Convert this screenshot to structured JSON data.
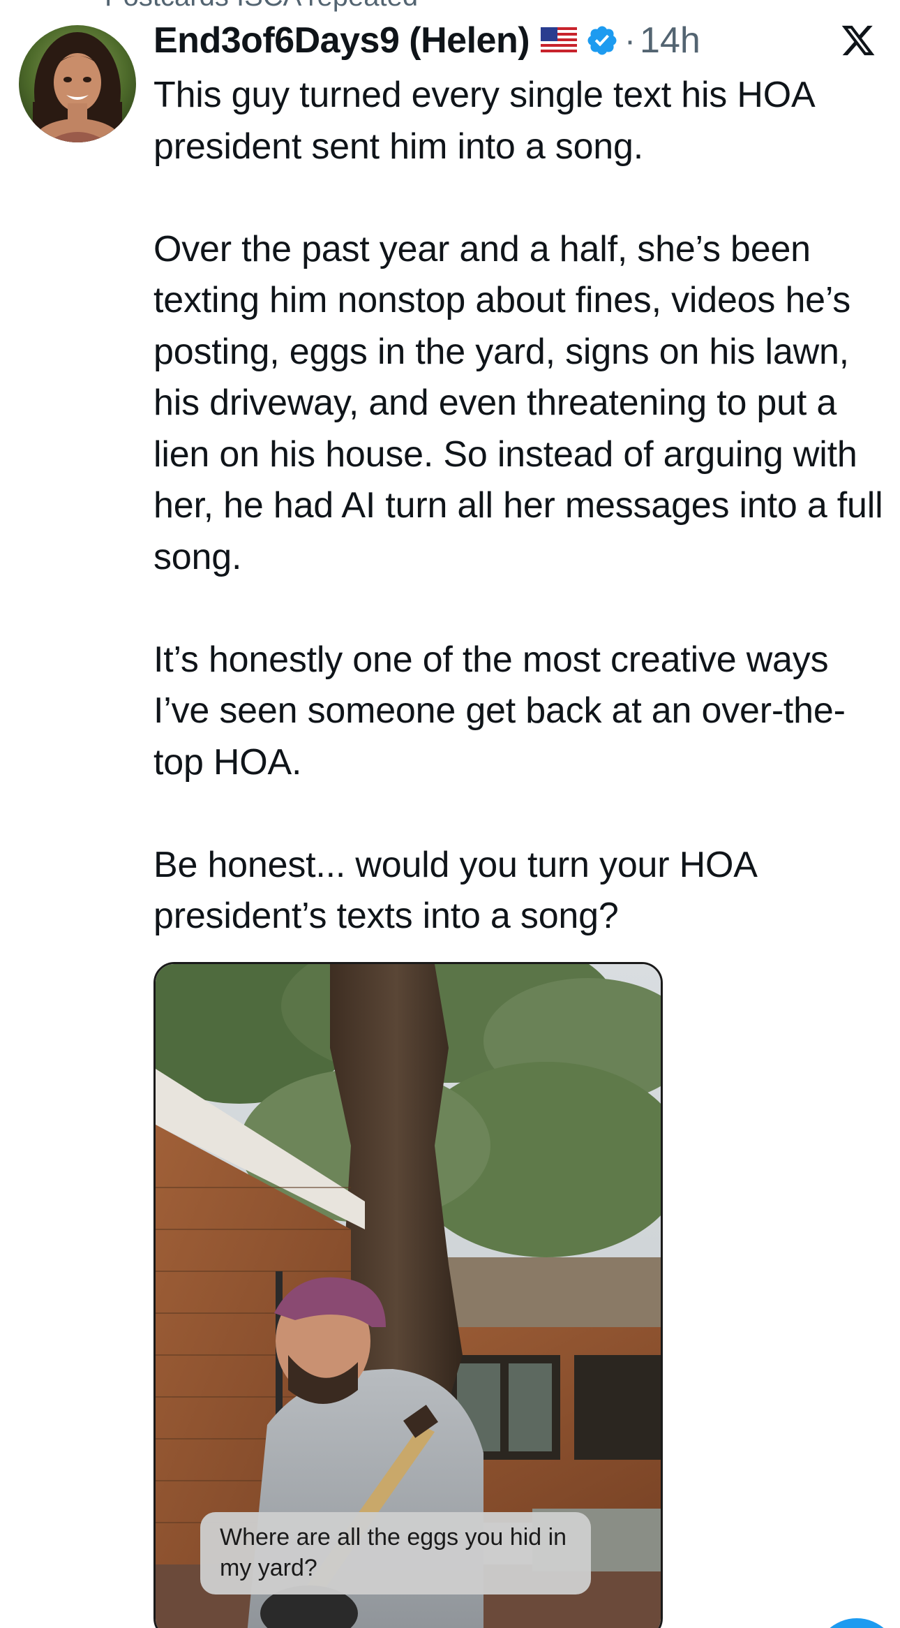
{
  "repost_header": {
    "text": "Postcards ISCA repeated"
  },
  "post": {
    "display_name": "End3of6Days9 (Helen)",
    "flag_icon": "us-flag-icon",
    "verified_icon": "verified-badge-icon",
    "separator": "·",
    "timestamp": "14h",
    "platform_icon": "x-logo-icon",
    "paragraphs": [
      "This guy turned every single text his HOA president sent him into a song.",
      "Over the past year and a half, she’s been texting him nonstop about fines, videos he’s posting, eggs in the yard, signs on his lawn, his driveway, and even threatening to put a lien on his house. So instead of arguing with her, he had AI turn all her messages into a full song.",
      "It’s honestly one of the most creative ways I’ve seen someone get back at an over-the-top HOA.",
      "Be honest... would you turn your HOA president’s texts into a song?"
    ],
    "media": {
      "caption": "Where are all the eggs you hid in my yard?"
    }
  },
  "colors": {
    "text_primary": "#0f1419",
    "text_secondary": "#536471",
    "verified_blue": "#1d9bf0",
    "fab_blue": "#1d9bf0"
  }
}
